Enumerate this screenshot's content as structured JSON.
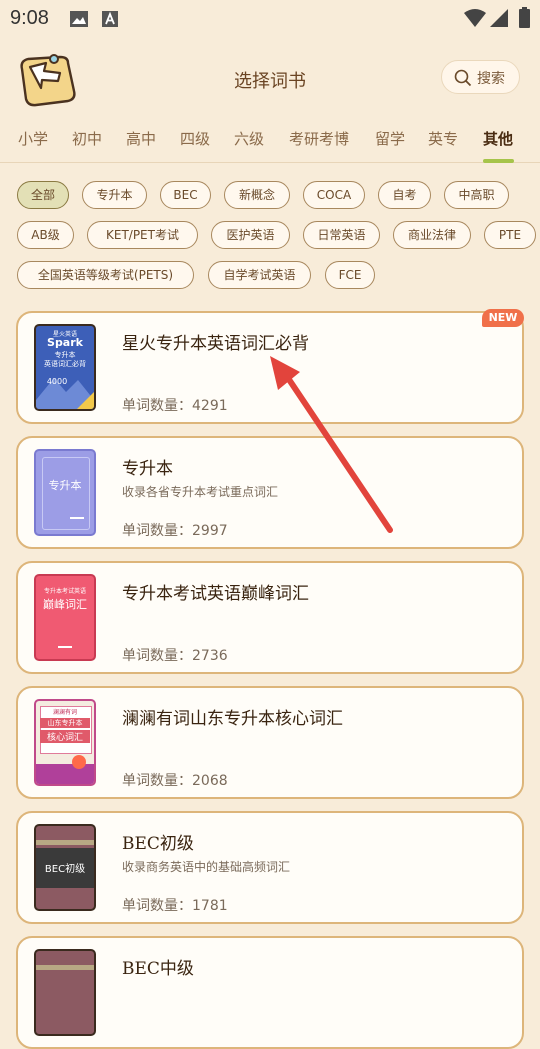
{
  "status_bar": {
    "time": "9:08"
  },
  "header": {
    "title": "选择词书",
    "search_label": "搜索"
  },
  "tabs": [
    {
      "label": "小学"
    },
    {
      "label": "初中"
    },
    {
      "label": "高中"
    },
    {
      "label": "四级"
    },
    {
      "label": "六级"
    },
    {
      "label": "考研考博"
    },
    {
      "label": "留学"
    },
    {
      "label": "英专"
    },
    {
      "label": "其他"
    }
  ],
  "active_tab": "其他",
  "filters": [
    {
      "label": "全部",
      "active": true
    },
    {
      "label": "专升本"
    },
    {
      "label": "BEC"
    },
    {
      "label": "新概念"
    },
    {
      "label": "COCA"
    },
    {
      "label": "自考"
    },
    {
      "label": "中高职"
    },
    {
      "label": "AB级"
    },
    {
      "label": "KET/PET考试"
    },
    {
      "label": "医护英语"
    },
    {
      "label": "日常英语"
    },
    {
      "label": "商业法律"
    },
    {
      "label": "PTE"
    },
    {
      "label": "全国英语等级考试(PETS)"
    },
    {
      "label": "自学考试英语"
    },
    {
      "label": "FCE"
    }
  ],
  "books": [
    {
      "title": "星火专升本英语词汇必背",
      "desc": "",
      "count": "单词数量：4291",
      "badge": "NEW",
      "cover": {
        "color": "#3d5fb8",
        "line1": "星火英语",
        "line2": "Spark",
        "line3": "专升本",
        "line4": "英语词汇必背",
        "line5": "4000"
      }
    },
    {
      "title": "专升本",
      "desc": "收录各省专升本考试重点词汇",
      "count": "单词数量：2997",
      "cover": {
        "color": "#9c9de6",
        "line1": "专升本"
      }
    },
    {
      "title": "专升本考试英语巅峰词汇",
      "desc": "",
      "count": "单词数量：2736",
      "cover": {
        "color": "#f05a72",
        "line1": "专升本考试英语",
        "line2": "巅峰词汇"
      }
    },
    {
      "title": "澜澜有词山东专升本核心词汇",
      "desc": "",
      "count": "单词数量：2068",
      "cover": {
        "color": "#f4ece0",
        "line1": "澜澜有词",
        "line2": "山东专升本",
        "line3": "核心词汇"
      }
    },
    {
      "title": "BEC初级",
      "desc": "收录商务英语中的基础高频词汇",
      "count": "单词数量：1781",
      "cover": {
        "color": "#8c5a62",
        "line1": "BEC初级"
      }
    },
    {
      "title": "BEC中级",
      "desc": "",
      "count": "",
      "cover": {
        "color": "#8c5a62",
        "line1": ""
      }
    }
  ],
  "colors": {
    "accent": "#a6c44a",
    "card_border": "#ddb57a",
    "background": "#f8ecd9",
    "annotation_arrow": "#e2443c"
  }
}
